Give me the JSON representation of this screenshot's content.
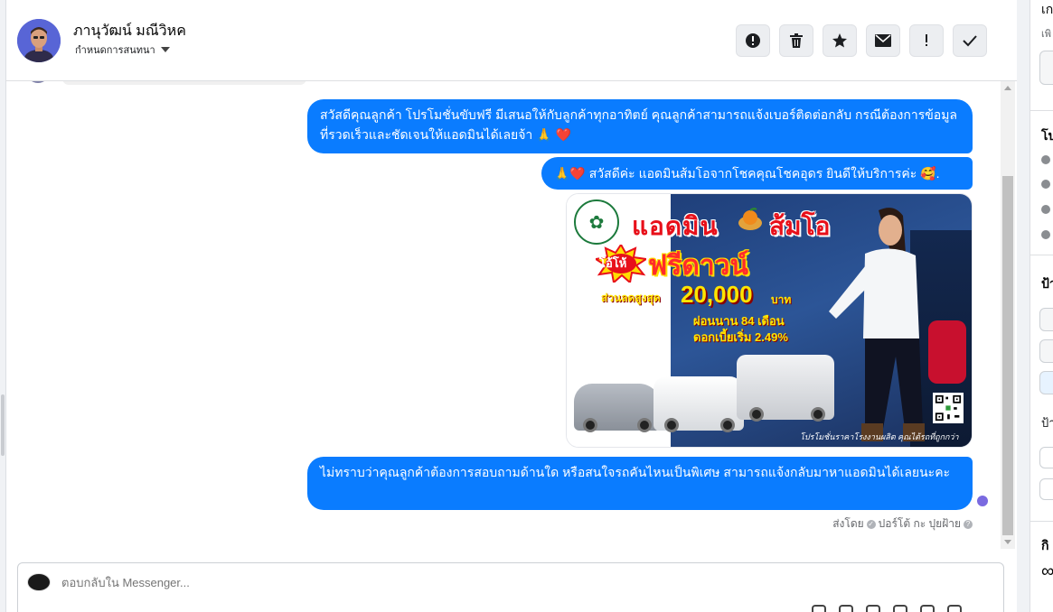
{
  "header": {
    "contact_name": "ภานุวัฒน์ มณีวิหค",
    "assign_label": "กำหนดการสนทนา",
    "actions": [
      {
        "name": "mark-spam-button",
        "icon": "alert-circle-icon",
        "glyph": "!"
      },
      {
        "name": "delete-button",
        "icon": "trash-icon",
        "glyph": "🗑"
      },
      {
        "name": "star-button",
        "icon": "star-icon",
        "glyph": "★"
      },
      {
        "name": "mark-unread-button",
        "icon": "envelope-icon",
        "glyph": "✉"
      },
      {
        "name": "follow-up-button",
        "icon": "exclamation-icon",
        "glyph": "!"
      },
      {
        "name": "mark-done-button",
        "icon": "checkmark-icon",
        "glyph": "✓"
      }
    ]
  },
  "messages": [
    {
      "type": "text",
      "text": "สวัสดีคุณลูกค้า โปรโมชั่นขับฟรี มีเสนอให้กับลูกค้าทุกอาทิตย์ คุณลูกค้าสามารถแจ้งเบอร์ติดต่อกลับ กรณีต้องการข้อมูลที่รวดเร็วและชัดเจนให้แอดมินได้เลยจ้า 🙏 ❤️"
    },
    {
      "type": "text",
      "text": "🙏❤️ สวัสดีค่ะ แอดมินส้มโอจากโชคคุณโชคอุดร ยินดีให้บริการค่ะ 🥰."
    },
    {
      "type": "image",
      "ad": {
        "title_part1": "แอดมิน",
        "title_part2": "ส้มโอ",
        "burst": "โอ้โห้",
        "free_text": "ฟรีดาวน์",
        "discount_label": "ส่วนลดสูงสุด",
        "discount_amount": "20,000",
        "currency": "บาท",
        "term": "ผ่อนนาน 84 เดือน",
        "rate": "ดอกเบี้ยเริ่ม 2.49%",
        "footer": "โปรโมชั่นราคาโรงงานผลิต คุณได้รถที่ถูกกว่า"
      }
    },
    {
      "type": "text",
      "text": "ไม่ทราบว่าคุณลูกค้าต้องการสอบถามด้านใด หรือสนใจรถคันไหนเป็นพิเศษ สามารถแจ้งกลับมาหาแอดมินได้เลยนะคะ"
    }
  ],
  "sent_by": {
    "prefix": "ส่งโดย",
    "name": "ปอร์โต้ กะ ปุยฝ้าย"
  },
  "composer": {
    "placeholder": "ตอบกลับใน Messenger..."
  },
  "sidebar": {
    "section1_title": "เก",
    "section1_sub": "เพิ",
    "section2_title": "โป",
    "section3_title": "ป้า",
    "section3_sub": "ป้า",
    "section4_title": "กิ",
    "section4_glyph": "∞"
  },
  "colors": {
    "bubble": "#0a7cff",
    "action_bg": "#eceef1"
  }
}
